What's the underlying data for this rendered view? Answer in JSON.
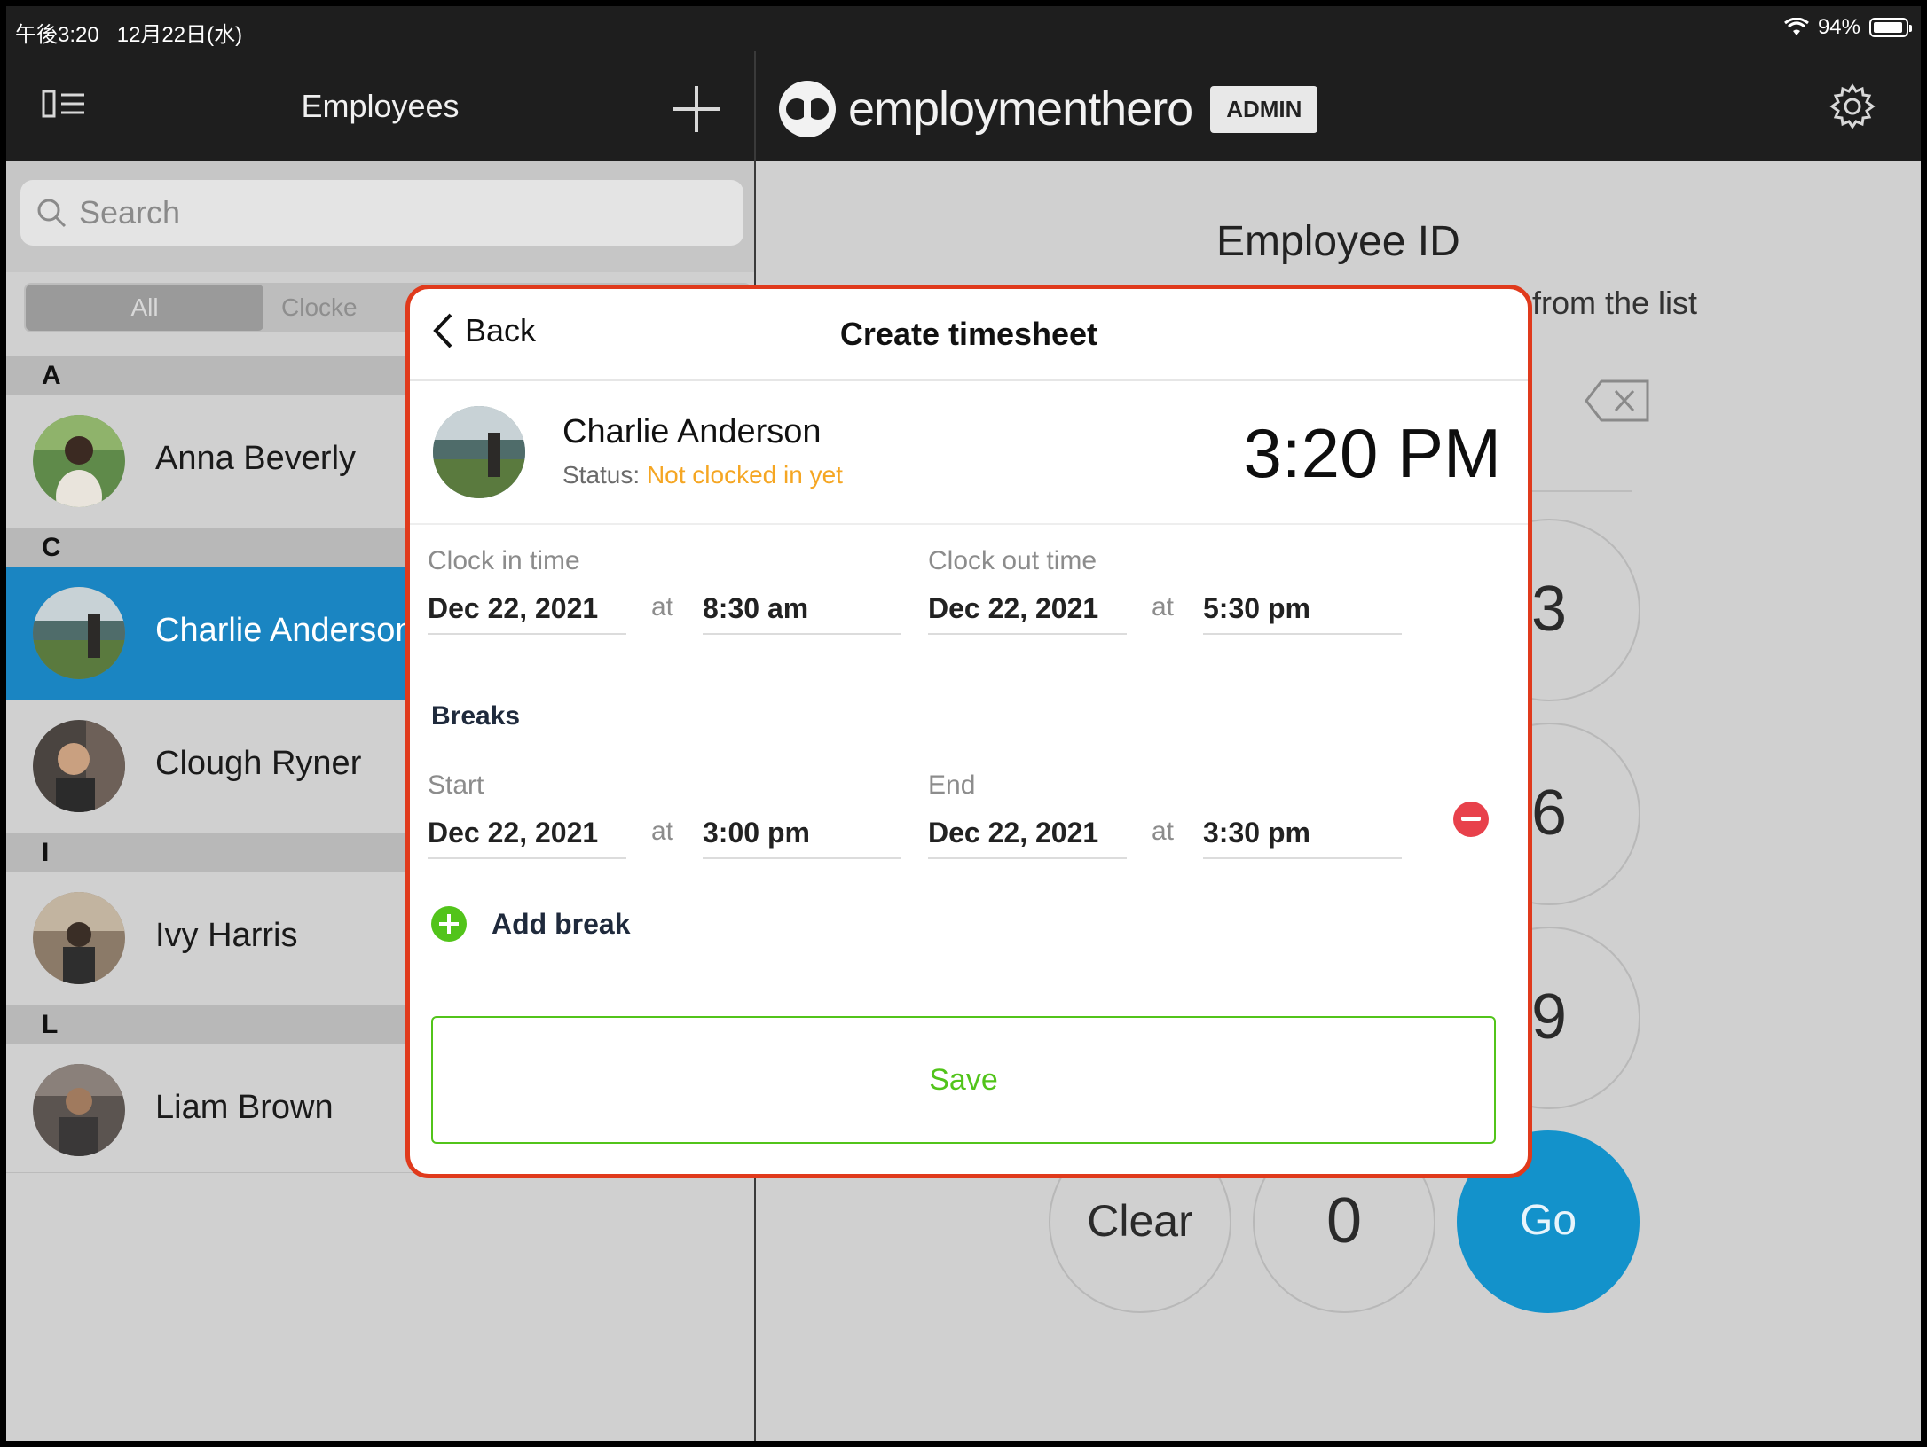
{
  "status_bar": {
    "time": "午後3:20",
    "date": "12月22日(水)",
    "battery": "94%",
    "battery_level": 0.94
  },
  "left_header": {
    "title": "Employees"
  },
  "brand": {
    "name": "employmenthero",
    "badge": "ADMIN"
  },
  "search": {
    "placeholder": "Search"
  },
  "segments": {
    "all": "All",
    "clocked": "Clocke"
  },
  "sections": [
    {
      "letter": "A",
      "employees": [
        "Anna Beverly"
      ]
    },
    {
      "letter": "C",
      "employees": [
        "Charlie Anderson",
        "Clough Ryner"
      ]
    },
    {
      "letter": "I",
      "employees": [
        "Ivy Harris"
      ]
    },
    {
      "letter": "L",
      "employees": [
        "Liam Brown"
      ]
    }
  ],
  "selected_employee": "Charlie Anderson",
  "keypad": {
    "title": "Employee ID",
    "hint": "from the list",
    "keys": [
      "3",
      "6",
      "9"
    ],
    "clear": "Clear",
    "zero": "0",
    "go": "Go"
  },
  "modal": {
    "back": "Back",
    "title": "Create timesheet",
    "employee_name": "Charlie Anderson",
    "status_label": "Status:",
    "status_value": "Not clocked in yet",
    "current_time": "3:20 PM",
    "clock_in": {
      "label": "Clock in time",
      "date": "Dec 22, 2021",
      "at": "at",
      "time": "8:30 am"
    },
    "clock_out": {
      "label": "Clock out time",
      "date": "Dec 22, 2021",
      "at": "at",
      "time": "5:30 pm"
    },
    "breaks_label": "Breaks",
    "break_start": {
      "label": "Start",
      "date": "Dec 22, 2021",
      "at": "at",
      "time": "3:00 pm"
    },
    "break_end": {
      "label": "End",
      "date": "Dec 22, 2021",
      "at": "at",
      "time": "3:30 pm"
    },
    "add_break": "Add break",
    "save": "Save"
  },
  "colors": {
    "accent_blue": "#1a85c2",
    "go_blue": "#1392cb",
    "status_orange": "#f5a623",
    "save_green": "#52c41a",
    "highlight_red": "#e03a1c",
    "remove_red": "#e8414b"
  }
}
